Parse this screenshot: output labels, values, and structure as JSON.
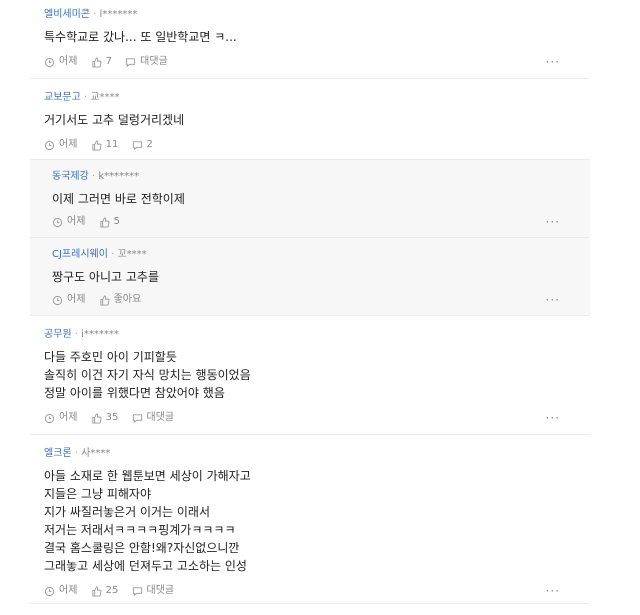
{
  "comments": [
    {
      "author": "엘비세미콘",
      "user": "l*******",
      "lines": [
        "특수학교로 갔나... 또 일반학교면 ㅋ..."
      ],
      "time": "어제",
      "likes": "7",
      "reply_label": "대댓글"
    },
    {
      "author": "교보문고",
      "user": "교****",
      "lines": [
        "거기서도 고추 덜렁거리겠네"
      ],
      "time": "어제",
      "likes": "11",
      "replies": "2"
    },
    {
      "author": "동국제강",
      "user": "k*******",
      "lines": [
        "이제 그러면 바로 전학이제"
      ],
      "time": "어제",
      "likes": "5",
      "is_reply": true
    },
    {
      "author": "CJ프레시웨이",
      "user": "꼬****",
      "lines": [
        "짱구도 아니고 고추를"
      ],
      "time": "어제",
      "likes": "좋아요",
      "is_reply": true
    },
    {
      "author": "공무원",
      "user": "i*******",
      "lines": [
        "다들 주호민 아이 기피할듯",
        "솔직히 이건 자기 자식 망치는 행동이었음",
        "정말 아이를 위했다면 참았어야 했음"
      ],
      "time": "어제",
      "likes": "35",
      "reply_label": "대댓글"
    },
    {
      "author": "엘크론",
      "user": "사****",
      "lines": [
        "아들 소재로 한 웹툰보면 세상이 가해자고",
        "지들은 그냥 피해자야",
        "지가 싸질러놓은거 이거는 이래서",
        "저거는 저래서ㅋㅋㅋㅋ핑계가ㅋㅋㅋㅋ",
        "결국 홈스쿨링은 안함!왜?자신없으니깐",
        "그래놓고 세상에 던져두고 고소하는 인성"
      ],
      "time": "어제",
      "likes": "25",
      "reply_label": "대댓글"
    }
  ],
  "more_label": "···"
}
